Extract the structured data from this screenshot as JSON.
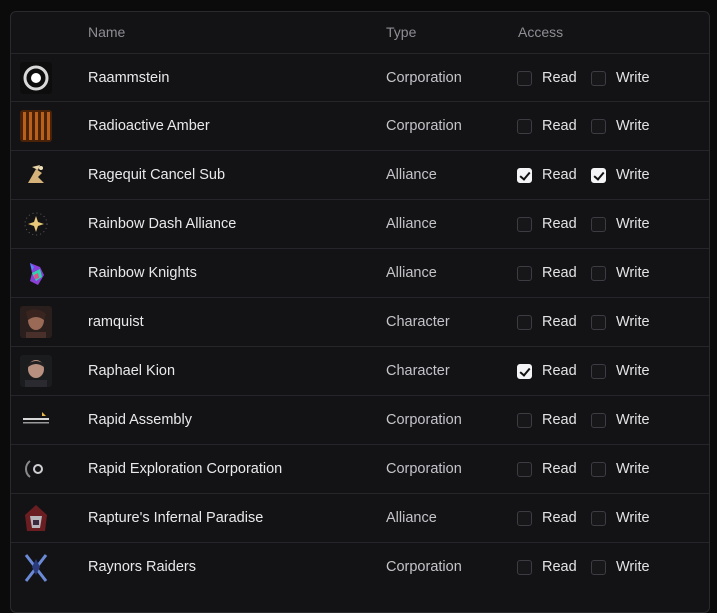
{
  "table": {
    "headers": {
      "name": "Name",
      "type": "Type",
      "access": "Access"
    },
    "read_label": "Read",
    "write_label": "Write",
    "rows": [
      {
        "name": "Raammstein",
        "type": "Corporation",
        "icon": "raammstein-logo-icon",
        "read": false,
        "write": false
      },
      {
        "name": "Radioactive Amber",
        "type": "Corporation",
        "icon": "radioactive-amber-logo-icon",
        "read": false,
        "write": false
      },
      {
        "name": "Ragequit Cancel Sub",
        "type": "Alliance",
        "icon": "ragequit-logo-icon",
        "read": true,
        "write": true
      },
      {
        "name": "Rainbow Dash Alliance",
        "type": "Alliance",
        "icon": "rainbow-dash-logo-icon",
        "read": false,
        "write": false
      },
      {
        "name": "Rainbow Knights",
        "type": "Alliance",
        "icon": "rainbow-knights-logo-icon",
        "read": false,
        "write": false
      },
      {
        "name": "ramquist",
        "type": "Character",
        "icon": "character-portrait-icon",
        "read": false,
        "write": false
      },
      {
        "name": "Raphael Kion",
        "type": "Character",
        "icon": "character-portrait-icon",
        "read": true,
        "write": false
      },
      {
        "name": "Rapid Assembly",
        "type": "Corporation",
        "icon": "rapid-assembly-logo-icon",
        "read": false,
        "write": false
      },
      {
        "name": "Rapid Exploration Corporation",
        "type": "Corporation",
        "icon": "rapid-exploration-logo-icon",
        "read": false,
        "write": false
      },
      {
        "name": "Rapture's Infernal Paradise",
        "type": "Alliance",
        "icon": "raptures-infernal-logo-icon",
        "read": false,
        "write": false
      },
      {
        "name": "Raynors Raiders",
        "type": "Corporation",
        "icon": "raynors-raiders-logo-icon",
        "read": false,
        "write": false
      }
    ]
  }
}
